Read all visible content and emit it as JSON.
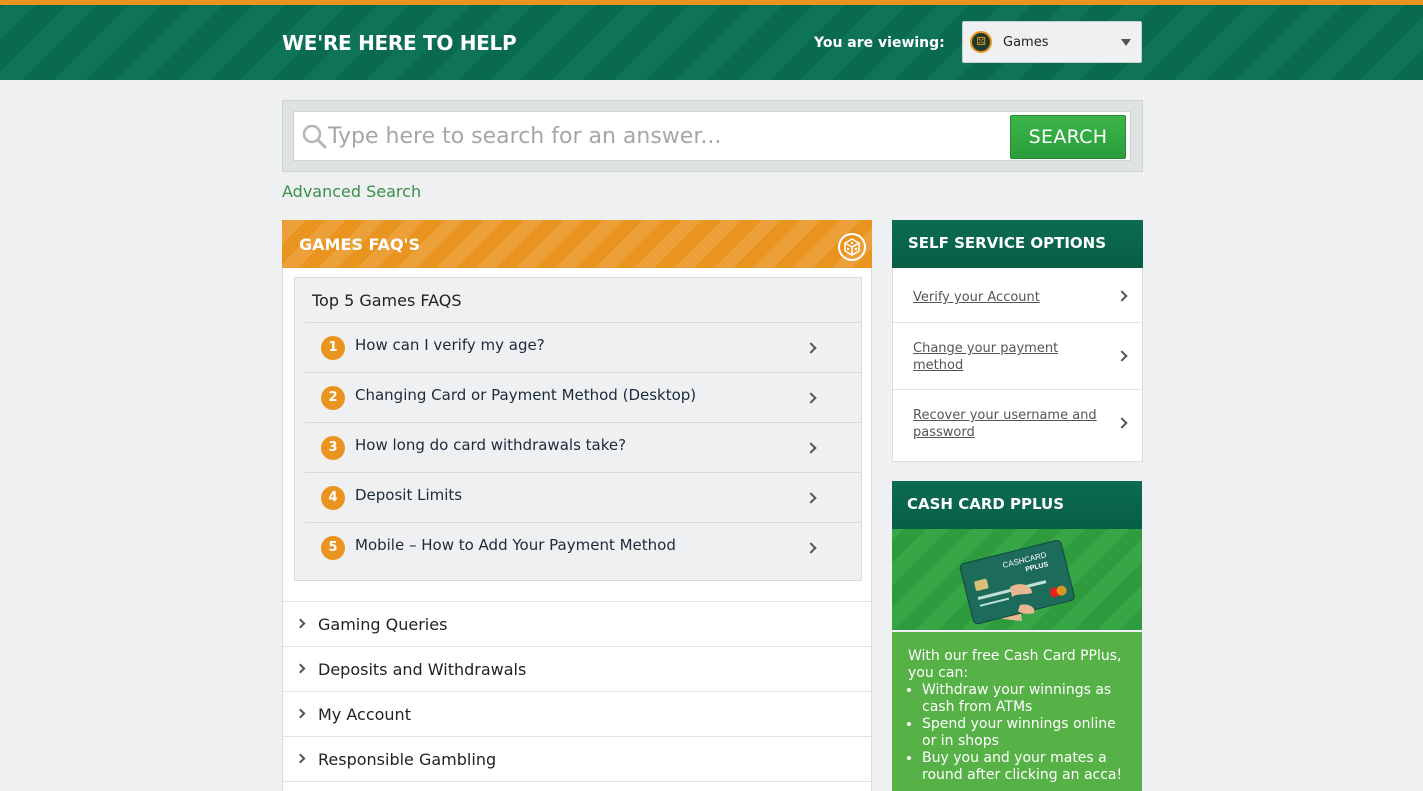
{
  "header": {
    "title": "WE'RE HERE TO HELP",
    "viewing_label": "You are viewing:",
    "product_select": {
      "value": "Games",
      "icon": "dice-icon"
    },
    "accent_color": "#e8941f",
    "bar_color": "#0a6a50"
  },
  "search": {
    "placeholder": "Type here to search for an answer...",
    "button_label": "SEARCH",
    "advanced_link": "Advanced Search"
  },
  "faq": {
    "header": "GAMES FAQ'S",
    "top5_title": "Top 5 Games FAQS",
    "items": [
      {
        "num": "1",
        "question": "How can I verify my age?"
      },
      {
        "num": "2",
        "question": "Changing Card or Payment Method (Desktop)"
      },
      {
        "num": "3",
        "question": "How long do card withdrawals take?"
      },
      {
        "num": "4",
        "question": "Deposit Limits"
      },
      {
        "num": "5",
        "question": "Mobile – How to Add Your Payment Method"
      }
    ]
  },
  "categories": [
    {
      "label": "Gaming Queries"
    },
    {
      "label": "Deposits and Withdrawals"
    },
    {
      "label": "My Account"
    },
    {
      "label": "Responsible Gambling"
    }
  ],
  "self_service": {
    "header": "SELF SERVICE OPTIONS",
    "items": [
      {
        "label": "Verify your Account"
      },
      {
        "label": "Change your payment method"
      },
      {
        "label": "Recover your username and password"
      }
    ]
  },
  "cash_card": {
    "header": "CASH CARD PPLUS",
    "card_brand": "CASHCARD",
    "card_sub": "PPLUS",
    "intro": "With our free Cash Card PPlus, you can:",
    "bullets": [
      "Withdraw your winnings as cash from ATMs",
      "Spend your winnings online or in shops",
      "Buy you and your mates a round after clicking an acca!"
    ]
  }
}
